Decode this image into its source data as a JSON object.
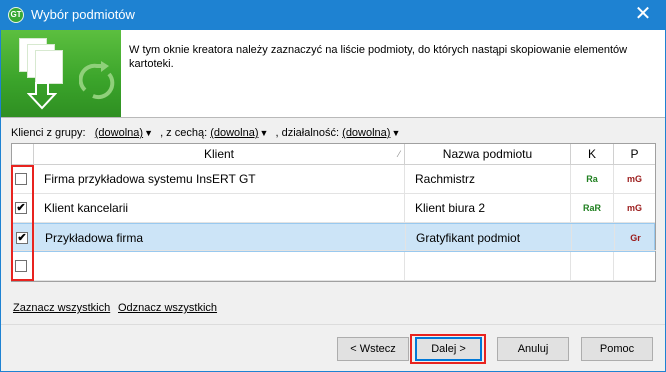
{
  "window": {
    "title": "Wybór podmiotów",
    "app_icon_text": "GT",
    "close_label": "✕"
  },
  "banner": {
    "text": "W tym oknie kreatora należy zaznaczyć na liście podmioty, do których nastąpi skopiowanie elementów kartoteki."
  },
  "filter": {
    "group_label": "Klienci z grupy:",
    "group_value": "(dowolna)",
    "feature_label": ", z cechą:",
    "feature_value": "(dowolna)",
    "activity_label": ", działalność:",
    "activity_value": "(dowolna)"
  },
  "table": {
    "columns": {
      "client": "Klient",
      "name": "Nazwa podmiotu",
      "k": "K",
      "p": "P"
    },
    "rows": [
      {
        "checked": false,
        "client": "Firma przykładowa systemu InsERT GT",
        "name": "Rachmistrz",
        "k": "Ra",
        "p": "mG",
        "k_color": "#1f7f1f",
        "p_color": "#9b1b1b",
        "selected": false
      },
      {
        "checked": true,
        "client": "Klient kancelarii",
        "name": "Klient biura 2",
        "k": "RaR",
        "p": "mG",
        "k_color": "#1f7f1f",
        "p_color": "#9b1b1b",
        "selected": false
      },
      {
        "checked": true,
        "client": "Przykładowa firma",
        "name": "Gratyfikant podmiot",
        "k": "",
        "p": "Gr",
        "k_color": "#1f7f1f",
        "p_color": "#9b1b1b",
        "selected": true
      },
      {
        "checked": false,
        "client": "",
        "name": "",
        "k": "",
        "p": "",
        "k_color": "#1f7f1f",
        "p_color": "#9b1b1b",
        "selected": false
      }
    ]
  },
  "links": {
    "select_all": "Zaznacz wszystkich",
    "deselect_all": "Odznacz wszystkich"
  },
  "buttons": {
    "back": "< Wstecz",
    "next": "Dalej >",
    "cancel": "Anuluj",
    "help": "Pomoc"
  },
  "colors": {
    "titlebar": "#1e82d2",
    "highlight": "#e8231f",
    "selected_row": "#cce4f7"
  }
}
